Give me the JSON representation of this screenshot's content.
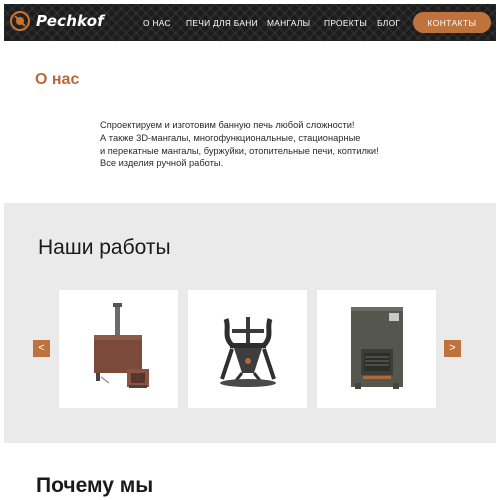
{
  "header": {
    "logo_text": "Pechkof",
    "nav": [
      "О НАС",
      "ПЕЧИ ДЛЯ БАНИ",
      "МАНГАЛЫ",
      "ПРОЕКТЫ",
      "БЛОГ"
    ],
    "contact_label": "КОНТАКТЫ"
  },
  "about": {
    "title": "О нас",
    "lines": [
      "Спроектируем и изготовим банную печь любой сложности!",
      "А также 3D-мангалы, многофункциональные, стационарные",
      "и перекатные мангалы, буржуйки, отопительные печи, коптилки!",
      "Все изделия ручной работы."
    ]
  },
  "works": {
    "title": "Наши работы",
    "prev_arrow": "<",
    "next_arrow": ">",
    "items": [
      "sauna-stove-image",
      "3d-grill-image",
      "heating-stove-image"
    ]
  },
  "why": {
    "title": "Почему мы"
  },
  "colors": {
    "accent": "#c0723d",
    "header_bg": "#1c1c1c",
    "section_bg": "#eaeaea"
  }
}
